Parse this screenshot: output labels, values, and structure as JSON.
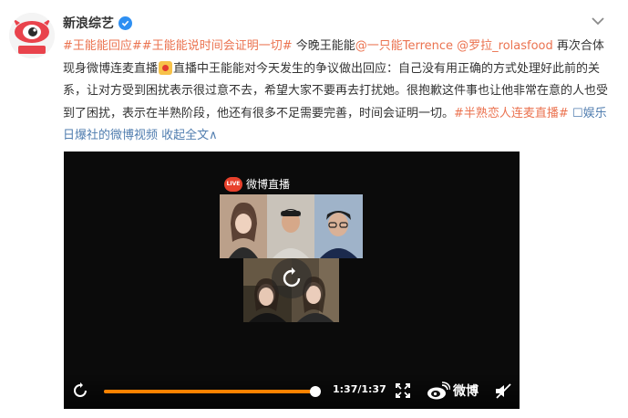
{
  "account": {
    "name": "新浪综艺",
    "avatar_text": "新浪综艺"
  },
  "post": {
    "hashtag1": "#王能能回应#",
    "hashtag2": "#王能能说时间会证明一切#",
    "text1": " 今晚王能能",
    "mention1": "@一只能Terrence",
    "mention2": " @罗拉_rolasfood",
    "text2": " 再次合体现身微博连麦直播",
    "text3": "直播中王能能对今天发生的争议做出回应：自己没有用正确的方式处理好此前的关系，让对方受到困扰表示很过意不去，希望大家不要再去打扰她。很抱歉这件事也让他非常在意的人也受到了困扰，表示在半熟阶段，他还有很多不足需要完善，时间会证明一切。",
    "hashtag3": "#半熟恋人连麦直播#",
    "video_link": " ☐娱乐日爆社的微博视频",
    "collapse_label": " 收起全文∧"
  },
  "video": {
    "live_brand": "微博直播",
    "live_icon_text": "LIVE",
    "time_display": "1:37/1:37",
    "progress": 1.0,
    "watermark": "微博"
  },
  "colors": {
    "accent_orange": "#ff8200",
    "link_orange": "#eb7350",
    "link_blue": "#507daf",
    "verified_blue": "#2e8ff2"
  }
}
